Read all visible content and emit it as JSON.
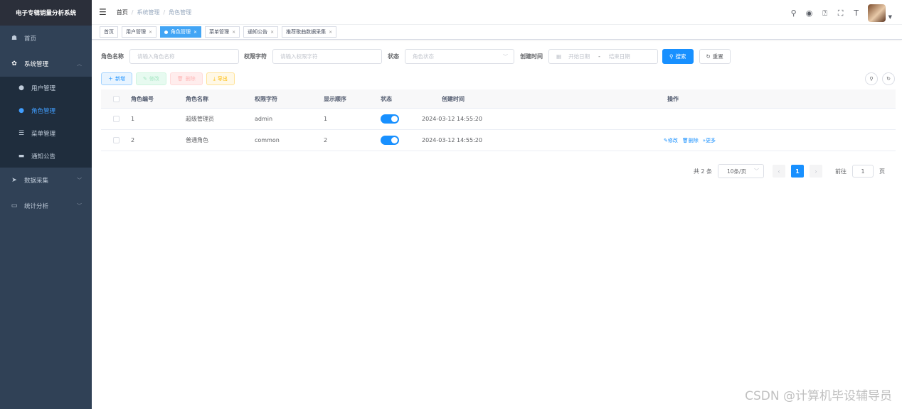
{
  "app_title": "电子专辑销量分析系统",
  "sidebar": {
    "items": [
      {
        "label": "首页",
        "icon": "dashboard-icon"
      },
      {
        "label": "系统管理",
        "icon": "gear-icon"
      },
      {
        "label": "数据采集",
        "icon": "paper-plane-icon"
      },
      {
        "label": "统计分析",
        "icon": "document-icon"
      }
    ],
    "sub_items": [
      {
        "label": "用户管理",
        "icon": "user-icon"
      },
      {
        "label": "角色管理",
        "icon": "users-icon"
      },
      {
        "label": "菜单管理",
        "icon": "tree-list-icon"
      },
      {
        "label": "通知公告",
        "icon": "message-icon"
      }
    ]
  },
  "breadcrumb": [
    "首页",
    "系统管理",
    "角色管理"
  ],
  "tags": [
    "首页",
    "用户管理",
    "角色管理",
    "菜单管理",
    "通知公告",
    "推荐歌曲数据采集"
  ],
  "search": {
    "role_name_label": "角色名称",
    "role_name_placeholder": "请输入角色名称",
    "role_key_label": "权限字符",
    "role_key_placeholder": "请输入权限字符",
    "status_label": "状态",
    "status_placeholder": "角色状态",
    "date_label": "创建时间",
    "start_placeholder": "开始日期",
    "date_sep": "-",
    "end_placeholder": "结束日期",
    "search_btn": "搜索",
    "reset_btn": "重置"
  },
  "toolbar": {
    "add": "新增",
    "edit": "修改",
    "delete": "删除",
    "export": "导出"
  },
  "table": {
    "headers": [
      "角色编号",
      "角色名称",
      "权限字符",
      "显示顺序",
      "状态",
      "创建时间",
      "操作"
    ],
    "rows": [
      {
        "id": "1",
        "name": "超级管理员",
        "key": "admin",
        "sort": "1",
        "status_on": true,
        "created": "2024-03-12 14:55:20"
      },
      {
        "id": "2",
        "name": "普通角色",
        "key": "common",
        "sort": "2",
        "status_on": true,
        "created": "2024-03-12 14:55:20"
      }
    ],
    "ops": {
      "edit": "修改",
      "delete": "删除",
      "more": "更多"
    }
  },
  "pagination": {
    "total": "共 2 条",
    "page_size": "10条/页",
    "current": "1",
    "goto_label": "前往",
    "goto_value": "1",
    "page_unit": "页"
  },
  "watermark": "CSDN @计算机毕设辅导员",
  "colors": {
    "sidebar_bg": "#304156",
    "primary": "#1890ff",
    "active_tag": "#42a5f5"
  }
}
